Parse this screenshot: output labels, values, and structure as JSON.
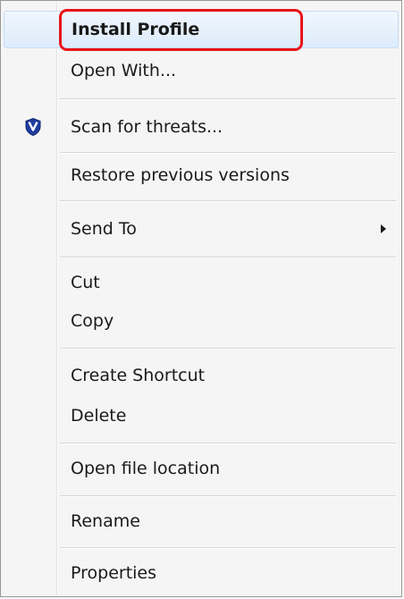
{
  "menu": {
    "items": [
      {
        "label": "Install Profile"
      },
      {
        "label": "Open With..."
      },
      {
        "label": "Scan for threats...",
        "icon": "shield-v-icon"
      },
      {
        "label": "Restore previous versions"
      },
      {
        "label": "Send To",
        "submenu_icon": "chevron-right-icon"
      },
      {
        "label": "Cut"
      },
      {
        "label": "Copy"
      },
      {
        "label": "Create Shortcut"
      },
      {
        "label": "Delete"
      },
      {
        "label": "Open file location"
      },
      {
        "label": "Rename"
      },
      {
        "label": "Properties"
      }
    ]
  },
  "colors": {
    "highlight_ring": "#e8141a",
    "shield": "#1f3d9e"
  }
}
